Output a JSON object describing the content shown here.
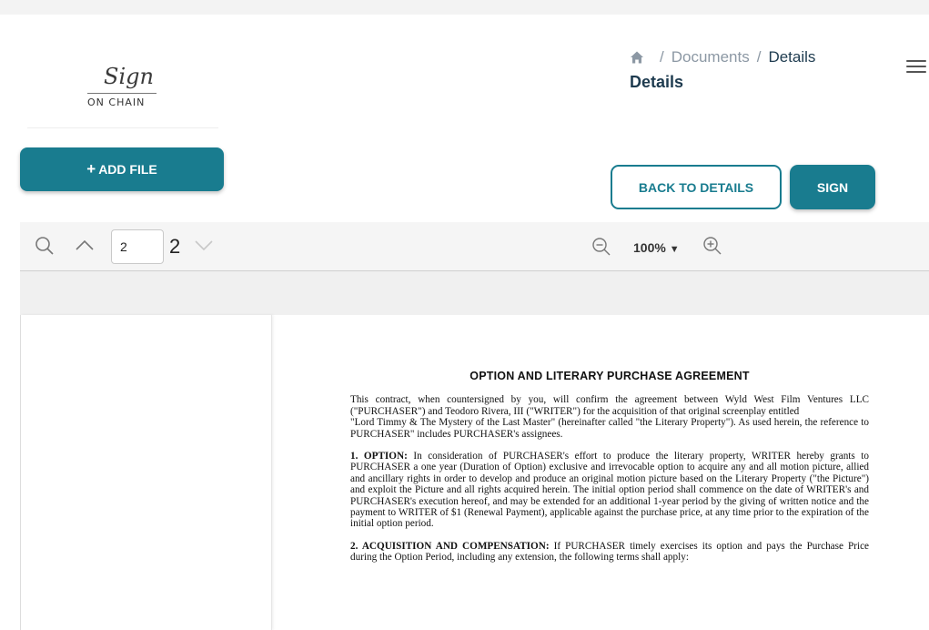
{
  "logo": {
    "script": "Sign",
    "text": "ON CHAIN"
  },
  "sidebar": {
    "add_file_label": "ADD FILE"
  },
  "breadcrumb": {
    "home_icon": "home-icon",
    "items": [
      "Documents",
      "Details"
    ]
  },
  "page": {
    "title": "Details"
  },
  "actions": {
    "back_label": "BACK TO DETAILS",
    "sign_label": "SIGN"
  },
  "toolbar": {
    "page_current": "2",
    "page_total": "2",
    "zoom": "100%",
    "icons": [
      "search-icon",
      "chevron-up-icon",
      "chevron-down-icon",
      "zoom-out-icon",
      "caret-down-icon",
      "zoom-in-icon"
    ]
  },
  "document": {
    "title": "OPTION AND LITERARY PURCHASE AGREEMENT",
    "intro": "This contract, when countersigned by you, will confirm the agreement between Wyld West Film Ventures LLC (\"PURCHASER\") and Teodoro Rivera, III (\"WRITER\") for the acquisition of that original screenplay entitled",
    "intro2": "\"Lord Timmy & The Mystery of the Last Master\" (hereinafter called \"the Literary Property\"). As used herein, the reference to PURCHASER\" includes PURCHASER's assignees.",
    "s1_heading": "1. OPTION:",
    "s1_text": "In consideration of PURCHASER's effort to produce the literary property, WRITER hereby grants to PURCHASER a one year (Duration of Option) exclusive and irrevocable option to acquire any and all motion picture, allied and ancillary rights in order to develop and produce an original motion picture based on the Literary Property (\"the Picture\") and exploit the Picture and all rights acquired herein. The initial option period shall commence on the date of WRITER's and PURCHASER's execution hereof, and may be extended for an additional 1-year period by the giving of written notice and the payment to WRITER of $1 (Renewal Payment), applicable against the purchase price, at any time prior to the expiration of the initial option period.",
    "s2_heading": "2. ACQUISITION AND COMPENSATION:",
    "s2_text": "If PURCHASER timely exercises its option and pays the Purchase Price during the Option Period, including any extension, the following terms shall apply:"
  },
  "colors": {
    "accent": "#197c8f",
    "title": "#1e3b4f",
    "muted": "#8c98a4"
  }
}
